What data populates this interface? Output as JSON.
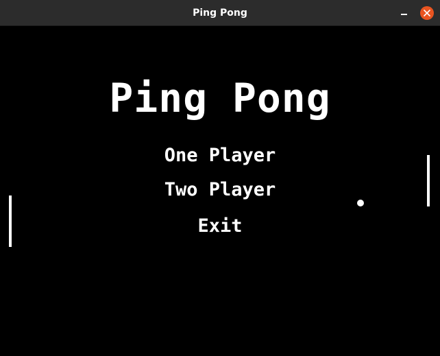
{
  "window": {
    "title": "Ping Pong",
    "controls": {
      "minimize_icon": "minimize-icon",
      "close_icon": "close-icon",
      "close_color": "#e95420"
    }
  },
  "game": {
    "title": "Ping Pong",
    "menu": [
      {
        "label": "One Player"
      },
      {
        "label": "Two Player"
      },
      {
        "label": "Exit"
      }
    ],
    "colors": {
      "background": "#000000",
      "foreground": "#ffffff"
    }
  }
}
